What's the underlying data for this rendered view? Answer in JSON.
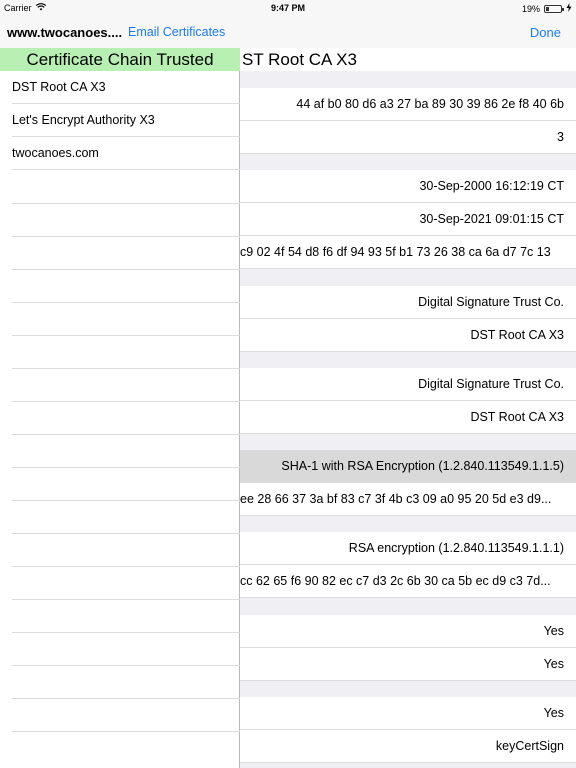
{
  "status_bar": {
    "carrier": "Carrier",
    "time": "9:47 PM",
    "battery": "19%",
    "battery_level": 0.19
  },
  "sidebar": {
    "title": "www.twocanoes....",
    "email_button": "Email Certificates",
    "trust_banner": "Certificate Chain Trusted",
    "certificates": [
      "DST Root CA X3",
      "Let's Encrypt Authority X3",
      "twocanoes.com"
    ]
  },
  "detail": {
    "done_button": "Done",
    "title": "ST Root CA X3",
    "rows": [
      "44 af b0 80 d6 a3 27 ba 89 30 39 86 2e f8 40 6b",
      "3",
      "30-Sep-2000 16:12:19 CT",
      "30-Sep-2021 09:01:15 CT",
      "c9 02 4f 54 d8 f6 df 94 93 5f b1 73 26 38 ca 6a d7 7c 13",
      "Digital Signature Trust Co.",
      "DST Root CA X3",
      "Digital Signature Trust Co.",
      "DST Root CA X3",
      "SHA-1 with RSA Encryption (1.2.840.113549.1.1.5)",
      "ee 28 66 37 3a bf 83 c7 3f 4b c3 09 a0 95 20 5d e3 d9...",
      "RSA encryption (1.2.840.113549.1.1.1)",
      "cc 62 65 f6 90 82 ec c7 d3 2c 6b 30 ca 5b ec d9 c3 7d...",
      "Yes",
      "Yes",
      "Yes",
      "keyCertSign"
    ]
  }
}
